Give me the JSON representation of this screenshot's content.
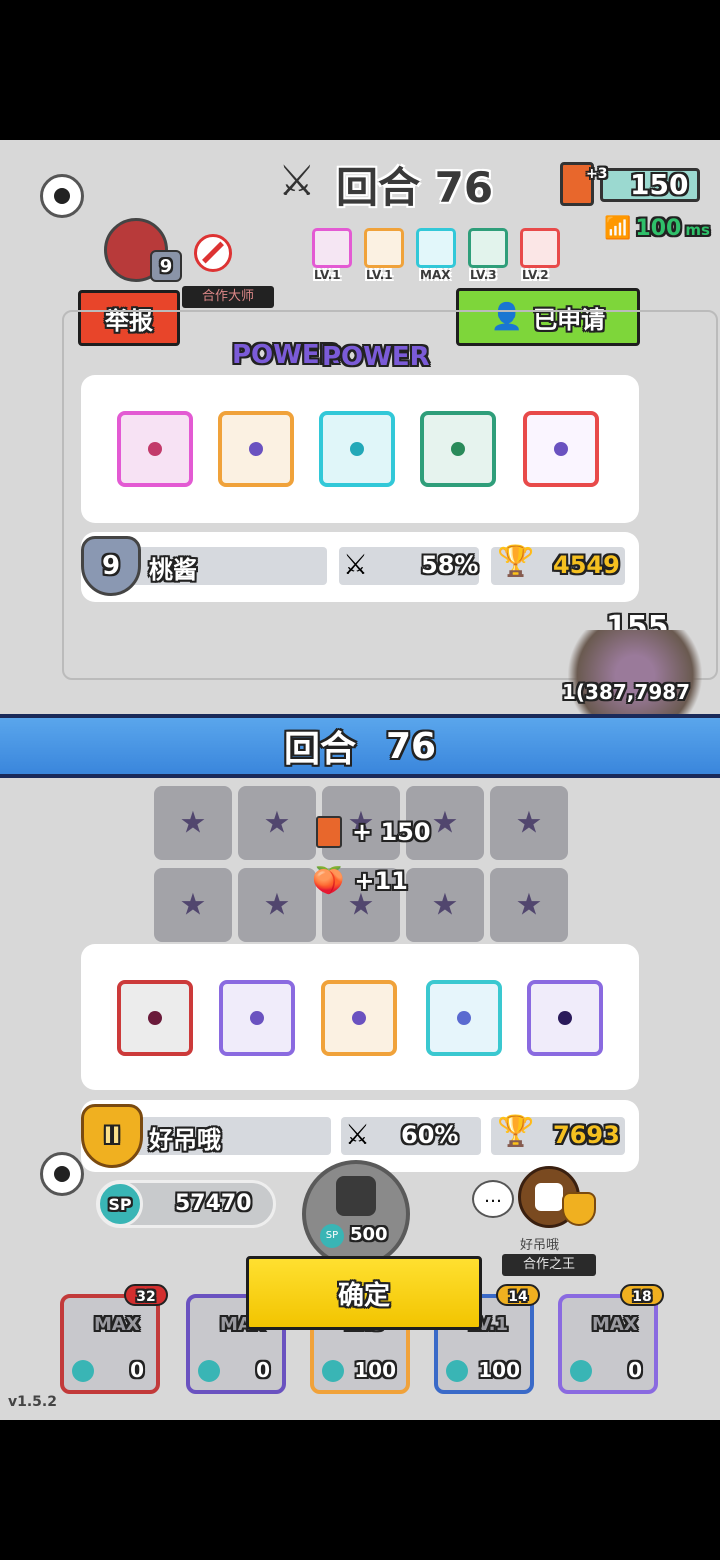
{
  "top_bar": {
    "round_label": "回合 76",
    "cards_count": "150",
    "cards_badge": "+3",
    "ping_value": "100",
    "ping_unit": "ms"
  },
  "opponent": {
    "level": "9",
    "title": "合作大师",
    "name": "桃酱",
    "win_rate": "58%",
    "trophies": "4549",
    "deck_levels": [
      "LV.1",
      "LV.1",
      "MAX",
      "LV.3",
      "LV.2"
    ],
    "report_label": "举报",
    "request_label": "已申请",
    "deck_colors": [
      "#e35ad3",
      "#f0a23a",
      "#32c8d8",
      "#2f9e7a",
      "#e84a4a"
    ]
  },
  "battle_overlay": {
    "power_label": "POWER",
    "boss_hp_label": "155",
    "boss_hp_full": "1(387,7987"
  },
  "round_banner": {
    "label": "回合",
    "number": "76"
  },
  "rewards": {
    "cards": "+ 150",
    "peach": "+11"
  },
  "player": {
    "rank": "II",
    "name": "好吊哦",
    "win_rate": "60%",
    "trophies": "7693",
    "title": "合作之王",
    "sp_label": "SP",
    "sp_value": "57470",
    "spawn_cost": "500",
    "deck_colors": [
      "#cc3a3a",
      "#8a6ae0",
      "#f0a23a",
      "#3ac8d0",
      "#8a6ae0"
    ]
  },
  "confirm_label": "确定",
  "bottom_deck": [
    {
      "level": "MAX",
      "badge": "32",
      "sp": "0",
      "color": "#c23a3a"
    },
    {
      "level": "MAX",
      "badge": "",
      "sp": "0",
      "color": "#6a52c0"
    },
    {
      "level": "LV.3",
      "badge": "",
      "sp": "100",
      "color": "#f0a23a"
    },
    {
      "level": "LV.1",
      "badge": "14",
      "sp": "100",
      "color": "#3ac8d0"
    },
    {
      "level": "MAX",
      "badge": "18",
      "sp": "0",
      "color": "#8a6ae0"
    }
  ],
  "version": "v1.5.2"
}
